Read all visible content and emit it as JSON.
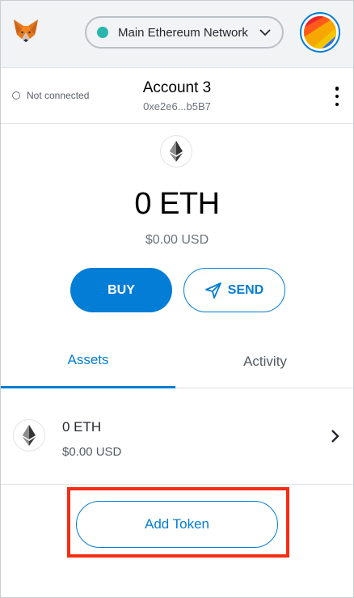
{
  "header": {
    "logo_icon": "metamask-fox-icon",
    "network": {
      "label": "Main Ethereum Network",
      "dot_color": "#29b6af"
    },
    "avatar_colors": [
      "#f6a800",
      "#ff5a1a",
      "#e8262b",
      "#2b74f0"
    ]
  },
  "account": {
    "connection_status": "Not connected",
    "name": "Account 3",
    "address": "0xe2e6...b5B7"
  },
  "balance": {
    "amount": "0 ETH",
    "fiat": "$0.00 USD"
  },
  "actions": {
    "buy_label": "BUY",
    "send_label": "SEND"
  },
  "tabs": [
    {
      "label": "Assets",
      "active": true
    },
    {
      "label": "Activity",
      "active": false
    }
  ],
  "assets": [
    {
      "amount": "0 ETH",
      "fiat": "$0.00 USD",
      "icon": "ethereum-icon"
    }
  ],
  "add_token_label": "Add Token",
  "colors": {
    "accent": "#037dd6",
    "highlight": "#f52d14"
  }
}
